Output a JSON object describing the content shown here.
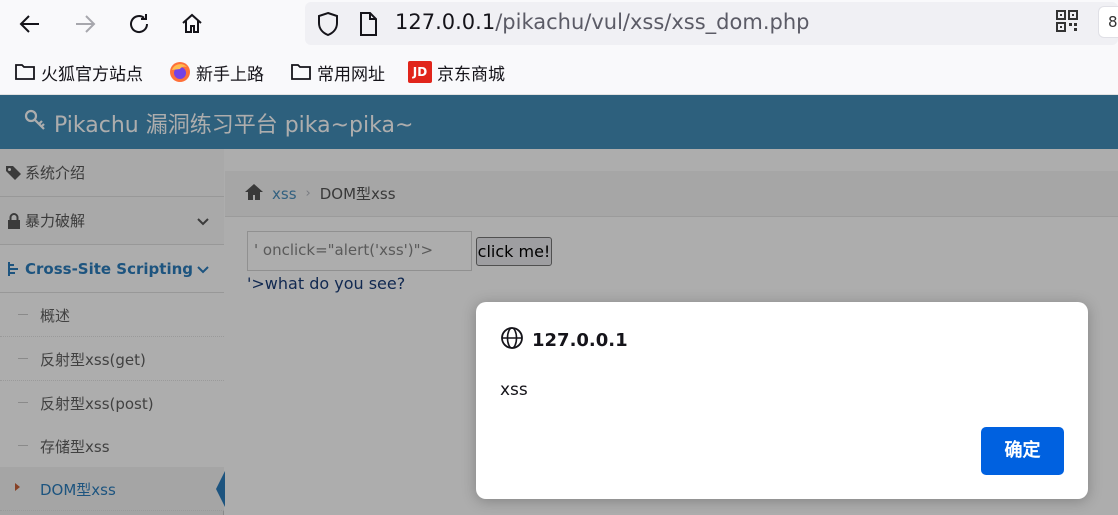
{
  "browser": {
    "url_host": "127.0.0.1",
    "url_path": "/pikachu/vul/xss/xss_dom.php",
    "pill_text": "8"
  },
  "bookmarks": [
    {
      "label": "火狐官方站点",
      "icon": "folder-icon"
    },
    {
      "label": "新手上路",
      "icon": "firefox-icon"
    },
    {
      "label": "常用网址",
      "icon": "folder-icon"
    },
    {
      "label": "京东商城",
      "icon": "jd-icon",
      "icon_text": "JD"
    }
  ],
  "header": {
    "title": "Pikachu 漏洞练习平台 pika~pika~"
  },
  "sidebar": {
    "items": [
      {
        "label": "系统介绍"
      },
      {
        "label": "暴力破解"
      },
      {
        "label": "Cross-Site Scripting"
      }
    ],
    "sub_items": [
      {
        "label": "概述"
      },
      {
        "label": "反射型xss(get)"
      },
      {
        "label": "反射型xss(post)"
      },
      {
        "label": "存储型xss"
      },
      {
        "label": "DOM型xss"
      }
    ]
  },
  "main": {
    "breadcrumb": {
      "parent": "xss",
      "current": "DOM型xss"
    },
    "input_value": "' onclick=\"alert('xss')\">",
    "button_label": "click me!",
    "output_text": "'>what do you see?"
  },
  "dialog": {
    "origin": "127.0.0.1",
    "message": "xss",
    "ok_label": "确定"
  },
  "colors": {
    "header": "#438eb9",
    "accent": "#2b7dbc",
    "ok_button": "#0061e0"
  }
}
